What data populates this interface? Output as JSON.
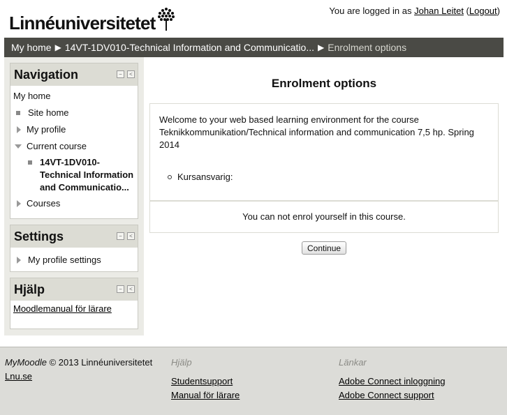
{
  "header": {
    "logo_text": "Linnéuniversitetet",
    "login_prefix": "You are logged in as ",
    "user_name": "Johan Leitet",
    "logout_label": "Logout",
    "paren_open": " (",
    "paren_close": ")"
  },
  "breadcrumb": {
    "items": [
      "My home",
      "14VT-1DV010-Technical Information and Communicatio...",
      "Enrolment options"
    ],
    "separator": "▶"
  },
  "blocks": {
    "navigation": {
      "title": "Navigation",
      "my_home": "My home",
      "site_home": "Site home",
      "my_profile": "My profile",
      "current_course": "Current course",
      "course_name": "14VT-1DV010-Technical Information and Communicatio...",
      "courses": "Courses"
    },
    "settings": {
      "title": "Settings",
      "my_profile_settings": "My profile settings"
    },
    "help": {
      "title": "Hjälp",
      "link": "Moodlemanual för lärare"
    },
    "controls": {
      "hide": "−",
      "dock": "<"
    }
  },
  "main": {
    "title": "Enrolment options",
    "summary": "Welcome to your web based learning environment for the course Teknikkommunikation/Technical information and communication 7,5 hp. Spring 2014",
    "contact_label": "Kursansvarig:",
    "notice": "You can not enrol yourself in this course.",
    "continue_label": "Continue"
  },
  "footer": {
    "brand": "MyMoodle",
    "copyright": " © 2013 Linnéuniversitetet",
    "site_link": "Lnu.se",
    "help_heading": "Hjälp",
    "help_links": [
      "Studentsupport",
      "Manual för lärare"
    ],
    "links_heading": "Länkar",
    "other_links": [
      "Adobe Connect inloggning",
      "Adobe Connect support"
    ]
  },
  "colors": {
    "navbar_bg": "#4a4a45",
    "block_header_bg": "#dcdcd4",
    "sidebar_bg": "#ebebe6",
    "footer_bg": "#dcdcd8"
  }
}
